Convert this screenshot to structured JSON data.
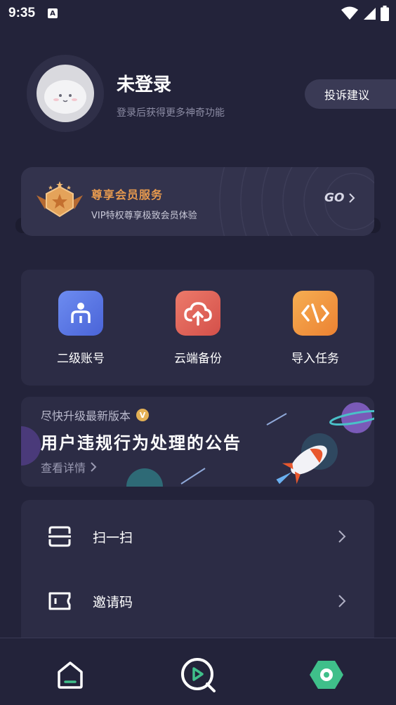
{
  "status_bar": {
    "time": "9:35",
    "notification_icon": "A",
    "icons": [
      "wifi-icon",
      "signal-icon",
      "battery-icon"
    ]
  },
  "profile": {
    "username": "未登录",
    "subtitle": "登录后获得更多神奇功能",
    "feedback_label": "投诉建议"
  },
  "vip": {
    "title": "尊享会员服务",
    "description": "VIP特权尊享极致会员体验",
    "go_label": "GO",
    "accent_color": "#e79a4e"
  },
  "quick_actions": [
    {
      "label": "二级账号",
      "icon": "sub-account-icon",
      "color": "#5b78e8"
    },
    {
      "label": "云端备份",
      "icon": "cloud-upload-icon",
      "color": "#e0675c"
    },
    {
      "label": "导入任务",
      "icon": "code-import-icon",
      "color": "#f0983e"
    }
  ],
  "banner": {
    "upgrade_text": "尽快升级最新版本",
    "badge": "V",
    "title": "用户违规行为处理的公告",
    "link_label": "查看详情"
  },
  "menu": [
    {
      "label": "扫一扫",
      "icon": "scan-icon"
    },
    {
      "label": "邀请码",
      "icon": "ticket-icon"
    }
  ],
  "tab_bar": {
    "tabs": [
      {
        "icon": "home-icon"
      },
      {
        "icon": "play-search-icon"
      },
      {
        "icon": "hexagon-settings-icon",
        "active": true
      }
    ],
    "active_color": "#3fbf8a"
  }
}
